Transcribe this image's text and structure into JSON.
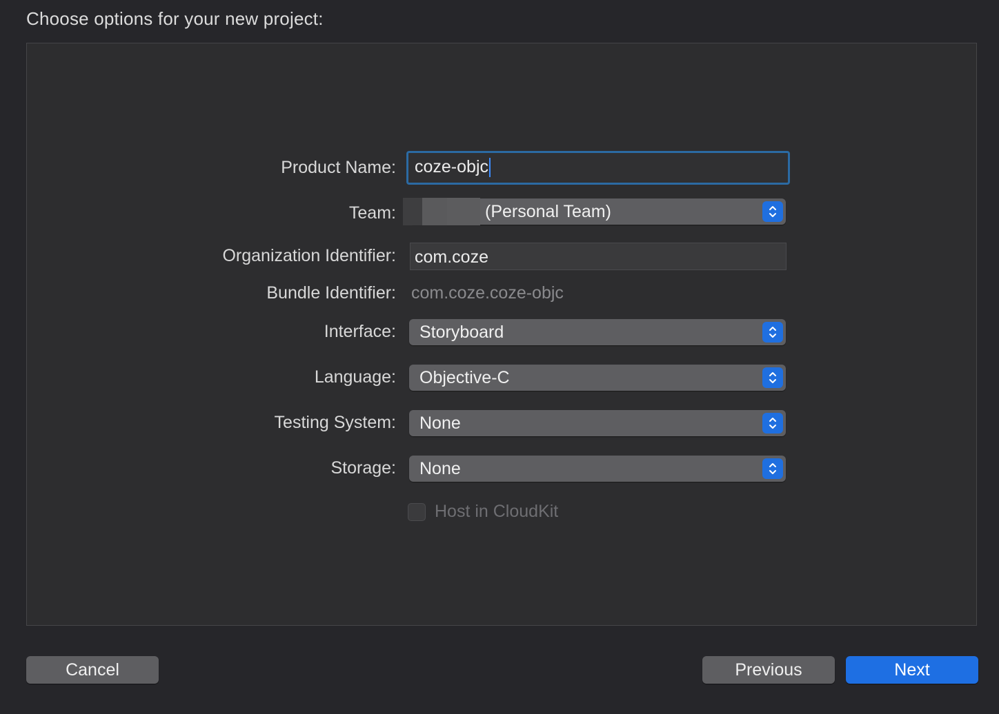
{
  "dialog": {
    "title": "Choose options for your new project:"
  },
  "form": {
    "product_name": {
      "label": "Product Name:",
      "value": "coze-objc"
    },
    "team": {
      "label": "Team:",
      "value": "(Personal Team)"
    },
    "organization_identifier": {
      "label": "Organization Identifier:",
      "value": "com.coze"
    },
    "bundle_identifier": {
      "label": "Bundle Identifier:",
      "value": "com.coze.coze-objc"
    },
    "interface": {
      "label": "Interface:",
      "value": "Storyboard"
    },
    "language": {
      "label": "Language:",
      "value": "Objective-C"
    },
    "testing_system": {
      "label": "Testing System:",
      "value": "None"
    },
    "storage": {
      "label": "Storage:",
      "value": "None"
    },
    "host_in_cloudkit": {
      "label": "Host in CloudKit",
      "checked": false,
      "enabled": false
    }
  },
  "buttons": {
    "cancel": "Cancel",
    "previous": "Previous",
    "next": "Next"
  },
  "icons": {
    "popup_stepper": "up-down-chevron-icon"
  },
  "colors": {
    "accent": "#1e6fe3",
    "focus_ring": "#2b6aa3",
    "background": "#26262a",
    "panel": "#2d2d2f"
  }
}
